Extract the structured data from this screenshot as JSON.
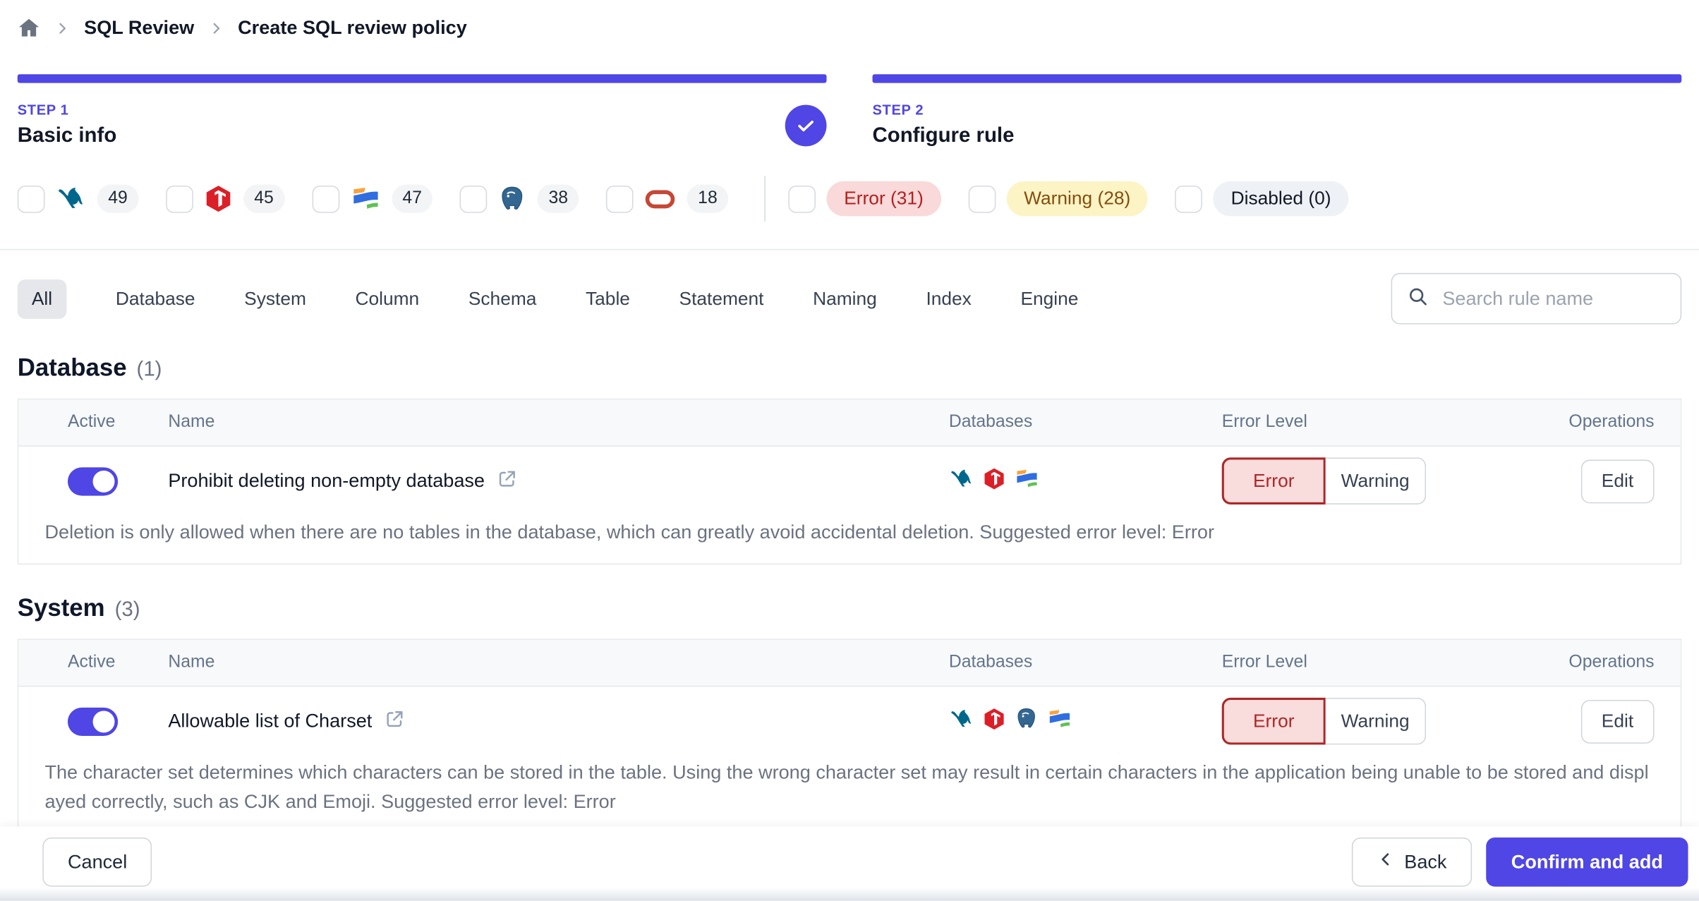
{
  "colors": {
    "accent": "#4f46e5",
    "error_text": "#b32020",
    "error_bg": "#f9d9d9",
    "warning_text": "#854d0e",
    "warning_bg": "#fdf4c5",
    "disabled_bg": "#eef1f5"
  },
  "breadcrumb": {
    "home_icon": "home-icon",
    "items": [
      "SQL Review",
      "Create SQL review policy"
    ]
  },
  "steps": [
    {
      "label": "STEP 1",
      "title": "Basic info",
      "completed": true
    },
    {
      "label": "STEP 2",
      "title": "Configure rule",
      "completed": false
    }
  ],
  "filters": {
    "engines": [
      {
        "icon": "mysql-icon",
        "count": "49"
      },
      {
        "icon": "tidb-icon",
        "count": "45"
      },
      {
        "icon": "oceanbase-icon",
        "count": "47"
      },
      {
        "icon": "postgresql-icon",
        "count": "38"
      },
      {
        "icon": "oracle-icon",
        "count": "18"
      }
    ],
    "levels": [
      {
        "label": "Error (31)"
      },
      {
        "label": "Warning (28)"
      },
      {
        "label": "Disabled (0)"
      }
    ]
  },
  "tabs": {
    "active": "All",
    "items": [
      "All",
      "Database",
      "System",
      "Column",
      "Schema",
      "Table",
      "Statement",
      "Naming",
      "Index",
      "Engine"
    ]
  },
  "search": {
    "placeholder": "Search rule name",
    "value": ""
  },
  "table": {
    "headers": [
      "Active",
      "Name",
      "Databases",
      "Error Level",
      "Operations"
    ]
  },
  "sections": [
    {
      "title": "Database",
      "count": "(1)",
      "rows": [
        {
          "active": true,
          "name": "Prohibit deleting non-empty database",
          "engines": [
            "mysql",
            "tidb",
            "oceanbase"
          ],
          "level_selected": "Error",
          "level_other": "Warning",
          "operation": "Edit",
          "description": "Deletion is only allowed when there are no tables in the database, which can greatly avoid accidental deletion. Suggested error level: Error"
        }
      ]
    },
    {
      "title": "System",
      "count": "(3)",
      "rows": [
        {
          "active": true,
          "name": "Allowable list of Charset",
          "engines": [
            "mysql",
            "tidb",
            "postgresql",
            "oceanbase"
          ],
          "level_selected": "Error",
          "level_other": "Warning",
          "operation": "Edit",
          "description": "The character set determines which characters can be stored in the table. Using the wrong character set may result in certain characters in the application being unable to be stored and displayed correctly, such as CJK and Emoji. Suggested error level: Error"
        }
      ]
    }
  ],
  "footer": {
    "cancel": "Cancel",
    "back": "Back",
    "confirm": "Confirm and add"
  }
}
